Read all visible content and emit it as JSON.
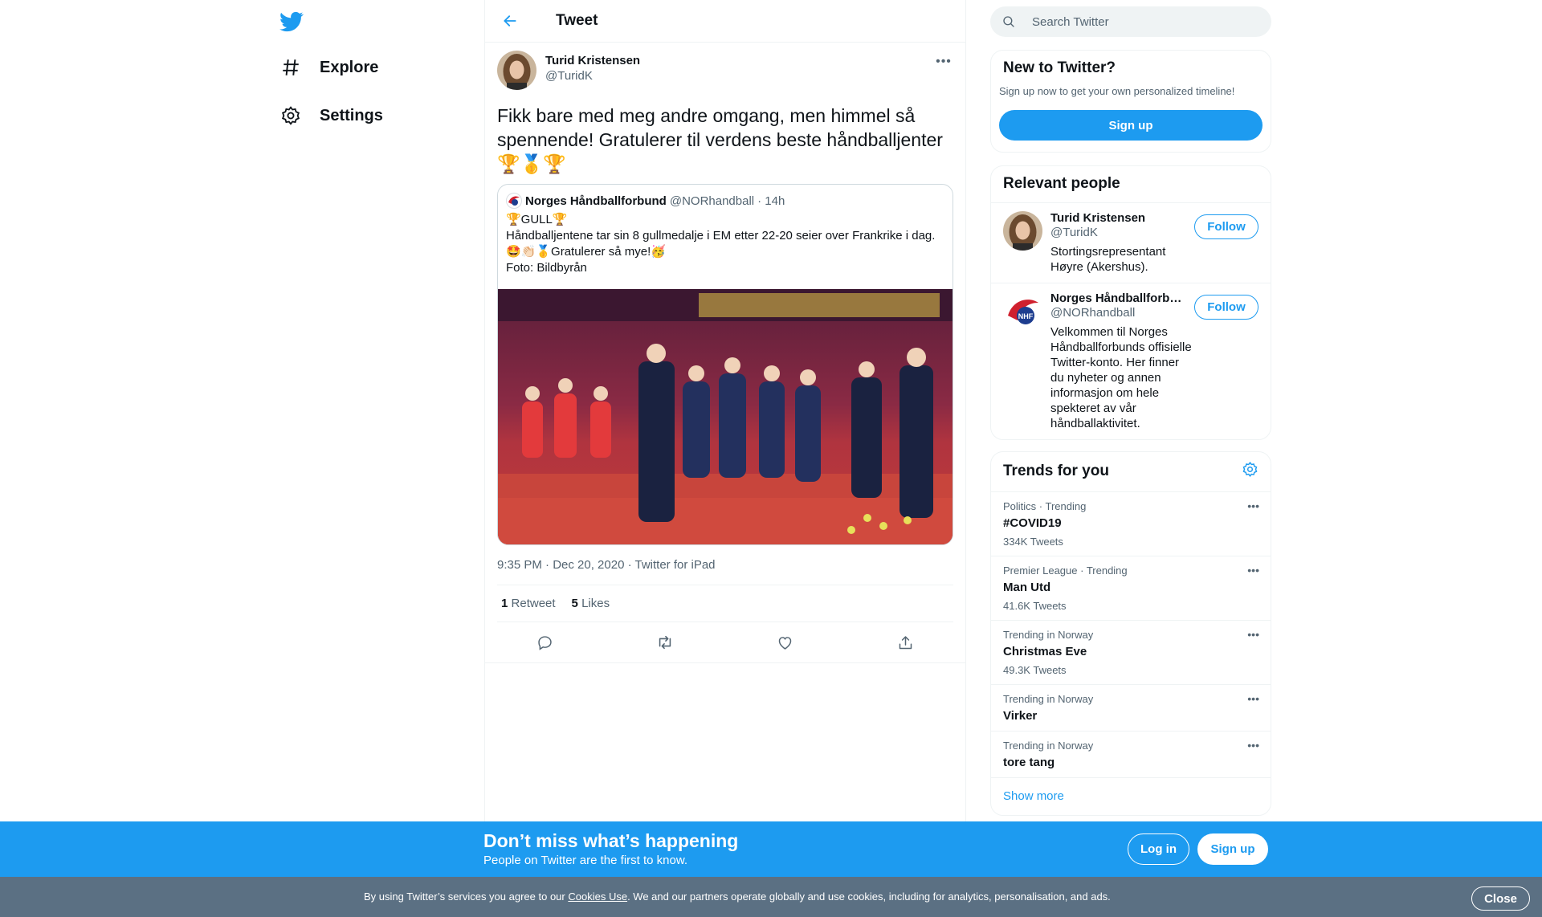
{
  "nav": {
    "logo_icon": "twitter-bird-icon",
    "items": [
      {
        "label": "Explore",
        "icon": "hashtag-icon"
      },
      {
        "label": "Settings",
        "icon": "gear-icon"
      }
    ]
  },
  "header": {
    "title": "Tweet"
  },
  "tweet": {
    "author_name": "Turid Kristensen",
    "author_handle": "@TuridK",
    "text": "Fikk bare med meg andre omgang, men himmel så spennende! Gratulerer til verdens beste håndballjenter 🏆🥇🏆",
    "quote": {
      "name": "Norges Håndballforbund",
      "handle": "@NORhandball",
      "age": "· 14h",
      "line1": "🏆GULL🏆",
      "line2": "Håndballjentene tar sin 8 gullmedalje i EM etter 22-20 seier over Frankrike i dag.",
      "line3": "🤩👏🏻🥇Gratulerer så mye!🥳",
      "line4": "Foto: Bildbyrån"
    },
    "timestamp": "9:35 PM · Dec 20, 2020 · Twitter for iPad",
    "retweets_count": "1",
    "retweets_label": "Retweet",
    "likes_count": "5",
    "likes_label": "Likes"
  },
  "search": {
    "placeholder": "Search Twitter"
  },
  "new_to_twitter": {
    "title": "New to Twitter?",
    "subtitle": "Sign up now to get your own personalized timeline!",
    "button": "Sign up"
  },
  "relevant_people": {
    "title": "Relevant people",
    "people": [
      {
        "name": "Turid Kristensen",
        "handle": "@TuridK",
        "bio": "Stortingsrepresentant Høyre (Akershus).",
        "follow": "Follow"
      },
      {
        "name": "Norges Håndballforb…",
        "handle": "@NORhandball",
        "bio": "Velkommen til Norges Håndballforbunds offisielle Twitter-konto. Her finner du nyheter og annen informasjon om hele spekteret av vår håndballaktivitet.",
        "follow": "Follow"
      }
    ]
  },
  "trends": {
    "title": "Trends for you",
    "items": [
      {
        "context": "Politics · Trending",
        "name": "#COVID19",
        "count": "334K Tweets"
      },
      {
        "context": "Premier League · Trending",
        "name": "Man Utd",
        "count": "41.6K Tweets"
      },
      {
        "context": "Trending in Norway",
        "name": "Christmas Eve",
        "count": "49.3K Tweets"
      },
      {
        "context": "Trending in Norway",
        "name": "Virker",
        "count": ""
      },
      {
        "context": "Trending in Norway",
        "name": "tore tang",
        "count": ""
      }
    ],
    "show_more": "Show more"
  },
  "bottom_bar": {
    "title": "Don’t miss what’s happening",
    "subtitle": "People on Twitter are the first to know.",
    "login": "Log in",
    "signup": "Sign up"
  },
  "cookie_bar": {
    "text_before": "By using Twitter’s services you agree to our ",
    "link": "Cookies Use",
    "text_after": ". We and our partners operate globally and use cookies, including for analytics, personalisation, and ads.",
    "close": "Close"
  },
  "colors": {
    "accent": "#1d9bf0",
    "cookie_bg": "#5b7083",
    "muted": "#536471"
  }
}
